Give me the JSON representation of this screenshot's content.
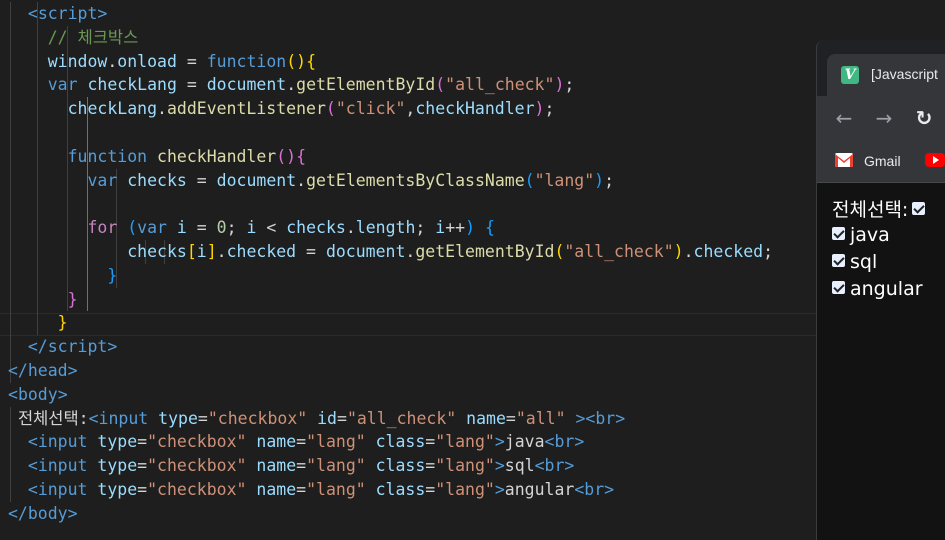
{
  "editor": {
    "lines": [
      [
        [
          "  ",
          "txt"
        ],
        [
          "<",
          "tag"
        ],
        [
          "script",
          "tag"
        ],
        [
          ">",
          "tag"
        ]
      ],
      [
        [
          "    ",
          "txt"
        ],
        [
          "// ",
          "cmt"
        ],
        [
          "체크박스",
          "cmt kr"
        ]
      ],
      [
        [
          "    ",
          "txt"
        ],
        [
          "window",
          "var"
        ],
        [
          ".",
          "txt"
        ],
        [
          "onload",
          "var"
        ],
        [
          " = ",
          "txt"
        ],
        [
          "function",
          "kw"
        ],
        [
          "()",
          "b1"
        ],
        [
          "{",
          "b1"
        ]
      ],
      [
        [
          "    ",
          "txt"
        ],
        [
          "var",
          "kw"
        ],
        [
          " ",
          "txt"
        ],
        [
          "checkLang",
          "var"
        ],
        [
          " = ",
          "txt"
        ],
        [
          "document",
          "var"
        ],
        [
          ".",
          "txt"
        ],
        [
          "getElementById",
          "fn"
        ],
        [
          "(",
          "b2"
        ],
        [
          "\"all_check\"",
          "str"
        ],
        [
          ")",
          "b2"
        ],
        [
          ";",
          "txt"
        ]
      ],
      [
        [
          "      ",
          "txt"
        ],
        [
          "checkLang",
          "var"
        ],
        [
          ".",
          "txt"
        ],
        [
          "addEventListener",
          "fn"
        ],
        [
          "(",
          "b2"
        ],
        [
          "\"click\"",
          "str"
        ],
        [
          ",",
          "txt"
        ],
        [
          "checkHandler",
          "var"
        ],
        [
          ")",
          "b2"
        ],
        [
          ";",
          "txt"
        ]
      ],
      [],
      [
        [
          "      ",
          "txt"
        ],
        [
          "function",
          "kw"
        ],
        [
          " ",
          "txt"
        ],
        [
          "checkHandler",
          "fn"
        ],
        [
          "()",
          "b2"
        ],
        [
          "{",
          "b2"
        ]
      ],
      [
        [
          "        ",
          "txt"
        ],
        [
          "var",
          "kw"
        ],
        [
          " ",
          "txt"
        ],
        [
          "checks",
          "var"
        ],
        [
          " = ",
          "txt"
        ],
        [
          "document",
          "var"
        ],
        [
          ".",
          "txt"
        ],
        [
          "getElementsByClassName",
          "fn"
        ],
        [
          "(",
          "b3"
        ],
        [
          "\"lang\"",
          "str"
        ],
        [
          ")",
          "b3"
        ],
        [
          ";",
          "txt"
        ]
      ],
      [],
      [
        [
          "        ",
          "txt"
        ],
        [
          "for",
          "ctl"
        ],
        [
          " ",
          "txt"
        ],
        [
          "(",
          "b3"
        ],
        [
          "var",
          "kw"
        ],
        [
          " ",
          "txt"
        ],
        [
          "i",
          "var"
        ],
        [
          " = ",
          "txt"
        ],
        [
          "0",
          "num"
        ],
        [
          "; ",
          "txt"
        ],
        [
          "i",
          "var"
        ],
        [
          " < ",
          "txt"
        ],
        [
          "checks",
          "var"
        ],
        [
          ".",
          "txt"
        ],
        [
          "length",
          "var"
        ],
        [
          "; ",
          "txt"
        ],
        [
          "i",
          "var"
        ],
        [
          "++",
          "txt"
        ],
        [
          ") ",
          "b3"
        ],
        [
          "{",
          "b3"
        ]
      ],
      [
        [
          "            ",
          "txt"
        ],
        [
          "checks",
          "var"
        ],
        [
          "[",
          "b1"
        ],
        [
          "i",
          "var"
        ],
        [
          "]",
          "b1"
        ],
        [
          ".",
          "txt"
        ],
        [
          "checked",
          "var"
        ],
        [
          " = ",
          "txt"
        ],
        [
          "document",
          "var"
        ],
        [
          ".",
          "txt"
        ],
        [
          "getElementById",
          "fn"
        ],
        [
          "(",
          "b1"
        ],
        [
          "\"all_check\"",
          "str"
        ],
        [
          ")",
          "b1"
        ],
        [
          ".",
          "txt"
        ],
        [
          "checked",
          "var"
        ],
        [
          ";",
          "txt"
        ]
      ],
      [
        [
          "          ",
          "txt"
        ],
        [
          "}",
          "b3"
        ]
      ],
      [
        [
          "      ",
          "txt"
        ],
        [
          "}",
          "b2"
        ]
      ],
      [
        [
          "     ",
          "txt"
        ],
        [
          "}",
          "b1"
        ]
      ],
      [
        [
          "  ",
          "txt"
        ],
        [
          "</",
          "tag"
        ],
        [
          "script",
          "tag"
        ],
        [
          ">",
          "tag"
        ]
      ],
      [
        [
          "</",
          "tag"
        ],
        [
          "head",
          "tag"
        ],
        [
          ">",
          "tag"
        ]
      ],
      [
        [
          "<",
          "tag"
        ],
        [
          "body",
          "tag"
        ],
        [
          ">",
          "tag"
        ]
      ],
      [
        [
          " ",
          "txt"
        ],
        [
          "전체선택",
          "txt kr"
        ],
        [
          ":",
          "txt"
        ],
        [
          "<",
          "tag"
        ],
        [
          "input",
          "tag"
        ],
        [
          " ",
          "txt"
        ],
        [
          "type",
          "attr"
        ],
        [
          "=",
          "txt"
        ],
        [
          "\"checkbox\"",
          "str"
        ],
        [
          " ",
          "txt"
        ],
        [
          "id",
          "attr"
        ],
        [
          "=",
          "txt"
        ],
        [
          "\"all_check\"",
          "str"
        ],
        [
          " ",
          "txt"
        ],
        [
          "name",
          "attr"
        ],
        [
          "=",
          "txt"
        ],
        [
          "\"all\"",
          "str"
        ],
        [
          " ",
          "txt"
        ],
        [
          ">",
          "tag"
        ],
        [
          "<",
          "tag"
        ],
        [
          "br",
          "tag"
        ],
        [
          ">",
          "tag"
        ]
      ],
      [
        [
          "  ",
          "txt"
        ],
        [
          "<",
          "tag"
        ],
        [
          "input",
          "tag"
        ],
        [
          " ",
          "txt"
        ],
        [
          "type",
          "attr"
        ],
        [
          "=",
          "txt"
        ],
        [
          "\"checkbox\"",
          "str"
        ],
        [
          " ",
          "txt"
        ],
        [
          "name",
          "attr"
        ],
        [
          "=",
          "txt"
        ],
        [
          "\"lang\"",
          "str"
        ],
        [
          " ",
          "txt"
        ],
        [
          "class",
          "attr"
        ],
        [
          "=",
          "txt"
        ],
        [
          "\"lang\"",
          "str"
        ],
        [
          ">",
          "tag"
        ],
        [
          "java",
          "txt"
        ],
        [
          "<",
          "tag"
        ],
        [
          "br",
          "tag"
        ],
        [
          ">",
          "tag"
        ]
      ],
      [
        [
          "  ",
          "txt"
        ],
        [
          "<",
          "tag"
        ],
        [
          "input",
          "tag"
        ],
        [
          " ",
          "txt"
        ],
        [
          "type",
          "attr"
        ],
        [
          "=",
          "txt"
        ],
        [
          "\"checkbox\"",
          "str"
        ],
        [
          " ",
          "txt"
        ],
        [
          "name",
          "attr"
        ],
        [
          "=",
          "txt"
        ],
        [
          "\"lang\"",
          "str"
        ],
        [
          " ",
          "txt"
        ],
        [
          "class",
          "attr"
        ],
        [
          "=",
          "txt"
        ],
        [
          "\"lang\"",
          "str"
        ],
        [
          ">",
          "tag"
        ],
        [
          "sql",
          "txt"
        ],
        [
          "<",
          "tag"
        ],
        [
          "br",
          "tag"
        ],
        [
          ">",
          "tag"
        ]
      ],
      [
        [
          "  ",
          "txt"
        ],
        [
          "<",
          "tag"
        ],
        [
          "input",
          "tag"
        ],
        [
          " ",
          "txt"
        ],
        [
          "type",
          "attr"
        ],
        [
          "=",
          "txt"
        ],
        [
          "\"checkbox\"",
          "str"
        ],
        [
          " ",
          "txt"
        ],
        [
          "name",
          "attr"
        ],
        [
          "=",
          "txt"
        ],
        [
          "\"lang\"",
          "str"
        ],
        [
          " ",
          "txt"
        ],
        [
          "class",
          "attr"
        ],
        [
          "=",
          "txt"
        ],
        [
          "\"lang\"",
          "str"
        ],
        [
          ">",
          "tag"
        ],
        [
          "angular",
          "txt"
        ],
        [
          "<",
          "tag"
        ],
        [
          "br",
          "tag"
        ],
        [
          ">",
          "tag"
        ]
      ],
      [
        [
          "</",
          "tag"
        ],
        [
          "body",
          "tag"
        ],
        [
          ">",
          "tag"
        ]
      ]
    ]
  },
  "browser": {
    "tab_title": "[Javascript",
    "favicon_letter": "V",
    "favicon_color": "#41b883",
    "back_icon": "←",
    "forward_icon": "→",
    "reload_icon": "↻",
    "bookmark_gmail": "Gmail",
    "page": {
      "all_label": "전체선택:",
      "items": [
        "java",
        "sql",
        "angular"
      ]
    }
  }
}
